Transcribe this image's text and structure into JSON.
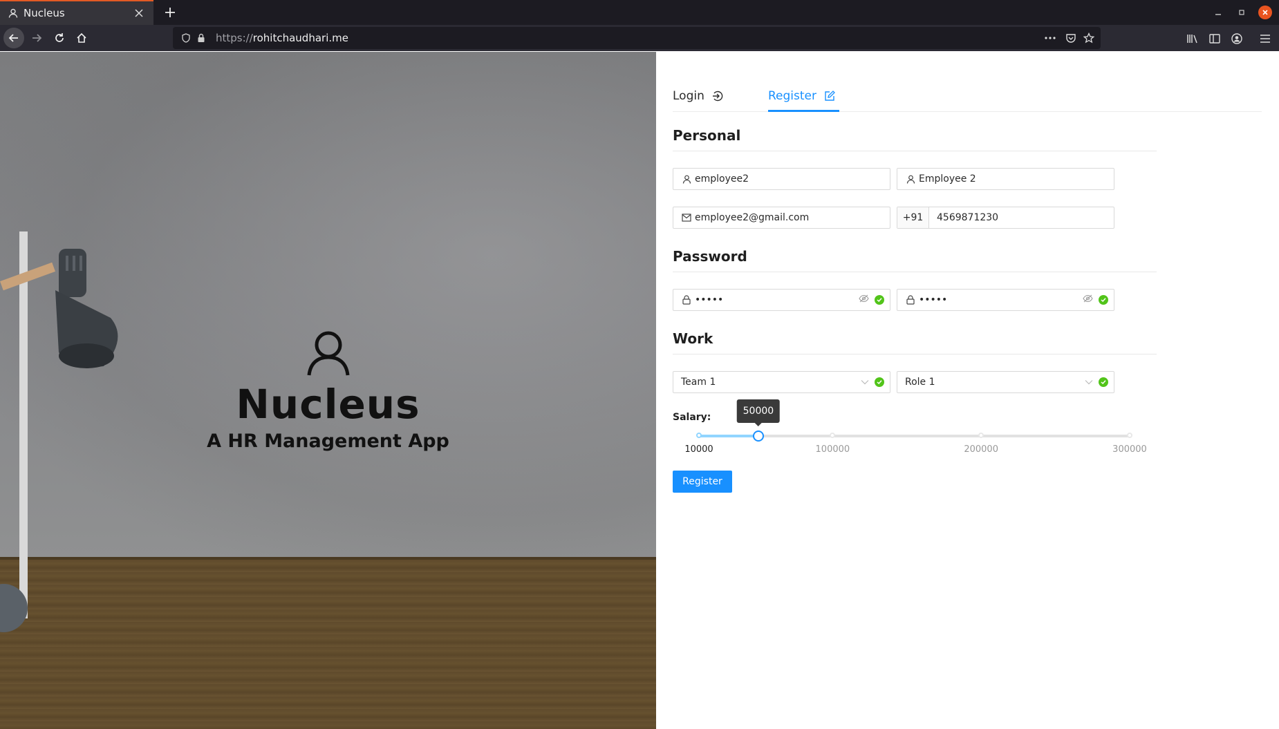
{
  "browser": {
    "tab_title": "Nucleus",
    "url_protocol": "https://",
    "url_host": "rohitchaudhari.me"
  },
  "hero": {
    "title": "Nucleus",
    "subtitle": "A HR Management App"
  },
  "tabs": {
    "login_label": "Login",
    "register_label": "Register",
    "active": "register"
  },
  "sections": {
    "personal": "Personal",
    "password": "Password",
    "work": "Work"
  },
  "personal": {
    "username": "employee2",
    "name": "Employee 2",
    "email": "employee2@gmail.com",
    "phone_prefix": "+91",
    "phone": "4569871230"
  },
  "password": {
    "password_masked": "•••••",
    "confirm_masked": "•••••"
  },
  "work": {
    "team": "Team 1",
    "role": "Role 1"
  },
  "salary": {
    "label": "Salary:",
    "value": 50000,
    "value_text": "50000",
    "min": 10000,
    "max": 300000,
    "marks": [
      "10000",
      "100000",
      "200000",
      "300000"
    ]
  },
  "submit_label": "Register",
  "colors": {
    "primary": "#1890ff",
    "success": "#52c41a"
  }
}
